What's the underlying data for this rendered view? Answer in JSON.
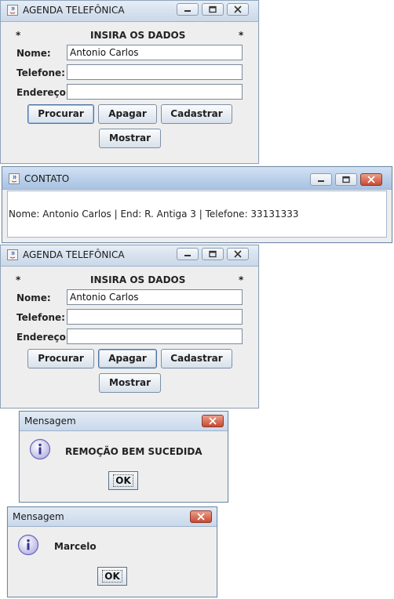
{
  "agenda": {
    "title": "AGENDA TELEFÔNICA",
    "star_left": "*",
    "star_right": "*",
    "heading": "INSIRA OS DADOS",
    "nome_label": "Nome:",
    "telefone_label": "Telefone:",
    "endereco_label": "Endereço:",
    "nome_value": "Antonio Carlos",
    "telefone_value": "",
    "endereco_value": "",
    "procurar": "Procurar",
    "apagar": "Apagar",
    "cadastrar": "Cadastrar",
    "mostrar": "Mostrar"
  },
  "contato": {
    "title": "CONTATO",
    "text": "Nome: Antonio Carlos | End: R. Antiga 3 | Telefone: 33131333"
  },
  "message1": {
    "title": "Mensagem",
    "text": "REMOÇÃO BEM SUCEDIDA",
    "ok": "OK"
  },
  "message2": {
    "title": "Mensagem",
    "text": "Marcelo",
    "ok": "OK"
  },
  "colors": {
    "close_button": "#c94a32",
    "titlebar": "#c8d7ea",
    "window_bg": "#eeeeee"
  }
}
